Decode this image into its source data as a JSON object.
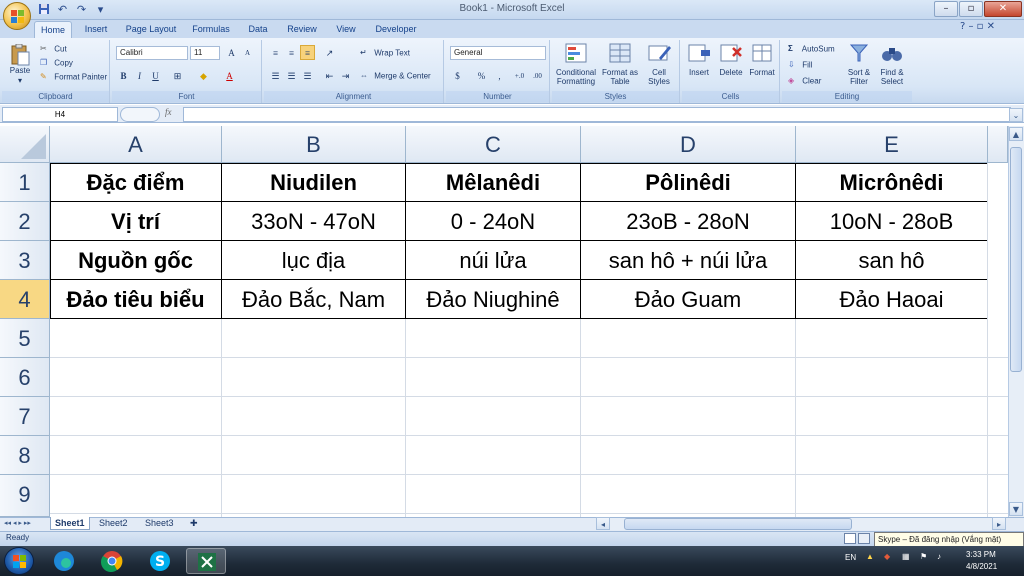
{
  "window": {
    "title": "Book1 - Microsoft Excel",
    "minimize": "–",
    "restore": "▫",
    "close": "✕"
  },
  "ribbon_tabs": [
    "Home",
    "Insert",
    "Page Layout",
    "Formulas",
    "Data",
    "Review",
    "View",
    "Developer"
  ],
  "help_icons": "? – ▫ ✕",
  "clipboard": {
    "paste": "Paste",
    "cut": "Cut",
    "copy": "Copy",
    "format_painter": "Format Painter",
    "label": "Clipboard"
  },
  "font": {
    "name": "Calibri",
    "size": "11",
    "grow": "A",
    "shrink": "A",
    "bold": "B",
    "italic": "I",
    "underline": "U",
    "font_color": "A",
    "label": "Font"
  },
  "alignment": {
    "wrap_text": "Wrap Text",
    "merge_center": "Merge & Center",
    "label": "Alignment"
  },
  "number": {
    "format": "General",
    "currency": "$",
    "percent": "%",
    "comma": ",",
    "inc_decimal": "+.0",
    "dec_decimal": ".00",
    "label": "Number"
  },
  "styles": {
    "conditional": "Conditional\nFormatting",
    "format_table": "Format as\nTable",
    "cell_styles": "Cell\nStyles",
    "label": "Styles"
  },
  "cells": {
    "insert": "Insert",
    "delete": "Delete",
    "format": "Format",
    "label": "Cells"
  },
  "editing": {
    "autosum": "AutoSum",
    "fill": "Fill",
    "clear": "Clear",
    "sort_filter": "Sort &\nFilter",
    "find_select": "Find &\nSelect",
    "label": "Editing"
  },
  "formula_bar": {
    "name_box": "H4",
    "fx": "fx",
    "value": ""
  },
  "columns": [
    "A",
    "B",
    "C",
    "D",
    "E"
  ],
  "rows": [
    "1",
    "2",
    "3",
    "4",
    "5",
    "6",
    "7",
    "8",
    "9"
  ],
  "selected_row": "4",
  "table": [
    [
      "Đặc điểm",
      "Niudilen",
      "Mêlanêdi",
      "Pôlinêdi",
      "Micrônêdi"
    ],
    [
      "Vị trí",
      "33oN - 47oN",
      "0 - 24oN",
      "23oB - 28oN",
      "10oN - 28oB"
    ],
    [
      "Nguồn gốc",
      "lục địa",
      "núi lửa",
      "san hô + núi lửa",
      "san hô"
    ],
    [
      "Đảo tiêu biểu",
      "Đảo Bắc, Nam",
      "Đảo Niughinê",
      "Đảo Guam",
      "Đảo Haoai"
    ]
  ],
  "sheets": [
    "Sheet1",
    "Sheet2",
    "Sheet3"
  ],
  "status": {
    "ready": "Ready",
    "skype": "Skype – Đã đăng nhập (Vắng mặt)"
  },
  "taskbar": {
    "lang": "EN",
    "time": "3:33 PM",
    "date": "4/8/2021"
  },
  "colors": {
    "selected_row_header": "#f8d884",
    "ribbon_text": "#15428b"
  }
}
